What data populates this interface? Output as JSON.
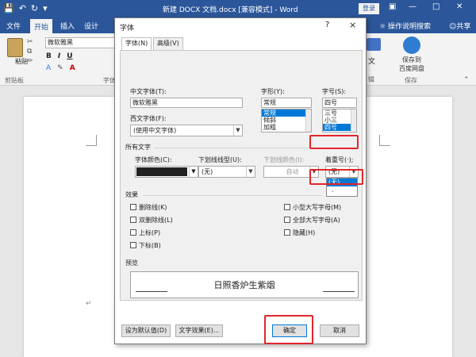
{
  "app": {
    "window_title": "新建 DOCX 文档.docx [兼容模式] - Word",
    "login_label": "登录",
    "colors": {
      "brand": "#2b579a",
      "highlight": "#e0262b",
      "selection": "#0078d7"
    }
  },
  "ribbon": {
    "tabs": [
      "文件",
      "开始",
      "插入",
      "设计"
    ],
    "active_tab": "开始",
    "tell_me": "操作说明搜索",
    "share": "共享",
    "paste_label": "粘贴",
    "clipboard_group": "剪贴板",
    "font_group": "字体",
    "font_name": "微软雅黑",
    "save_cloud_line1": "保存到",
    "save_cloud_line2": "百度网盘",
    "save_group": "保存",
    "edit_hint": "文",
    "edit_hint2": "辑"
  },
  "dialog": {
    "title": "字体",
    "help": "?",
    "close": "×",
    "tabs": [
      "字体(N)",
      "高级(V)"
    ],
    "cn_font_label": "中文字体(T):",
    "cn_font_value": "微软雅黑",
    "west_font_label": "西文字体(F):",
    "west_font_value": "(使用中文字体)",
    "style_label": "字形(Y):",
    "style_value": "常规",
    "style_options": [
      "常规",
      "倾斜",
      "加粗"
    ],
    "size_label": "字号(S):",
    "size_value": "四号",
    "size_options": [
      "三号",
      "小三",
      "四号"
    ],
    "all_text_label": "所有文字",
    "font_color_label": "字体颜色(C):",
    "underline_type_label": "下划线线型(U):",
    "underline_type_value": "(无)",
    "underline_color_label": "下划线颜色(I):",
    "underline_color_value": "自动",
    "emphasis_label": "着重号(·);",
    "emphasis_value": "(无)",
    "emphasis_options": [
      "(无)",
      "."
    ],
    "effects_label": "效果",
    "effects_left": [
      "删除线(K)",
      "双删除线(L)",
      "上标(P)",
      "下标(B)"
    ],
    "effects_right": [
      "小型大写字母(M)",
      "全部大写字母(A)",
      "隐藏(H)"
    ],
    "preview_label": "预览",
    "preview_text": "日照香炉生紫烟",
    "set_default_button": "设为默认值(D)",
    "text_effects_button": "文字效果(E)...",
    "ok_button": "确定",
    "cancel_button": "取消"
  }
}
